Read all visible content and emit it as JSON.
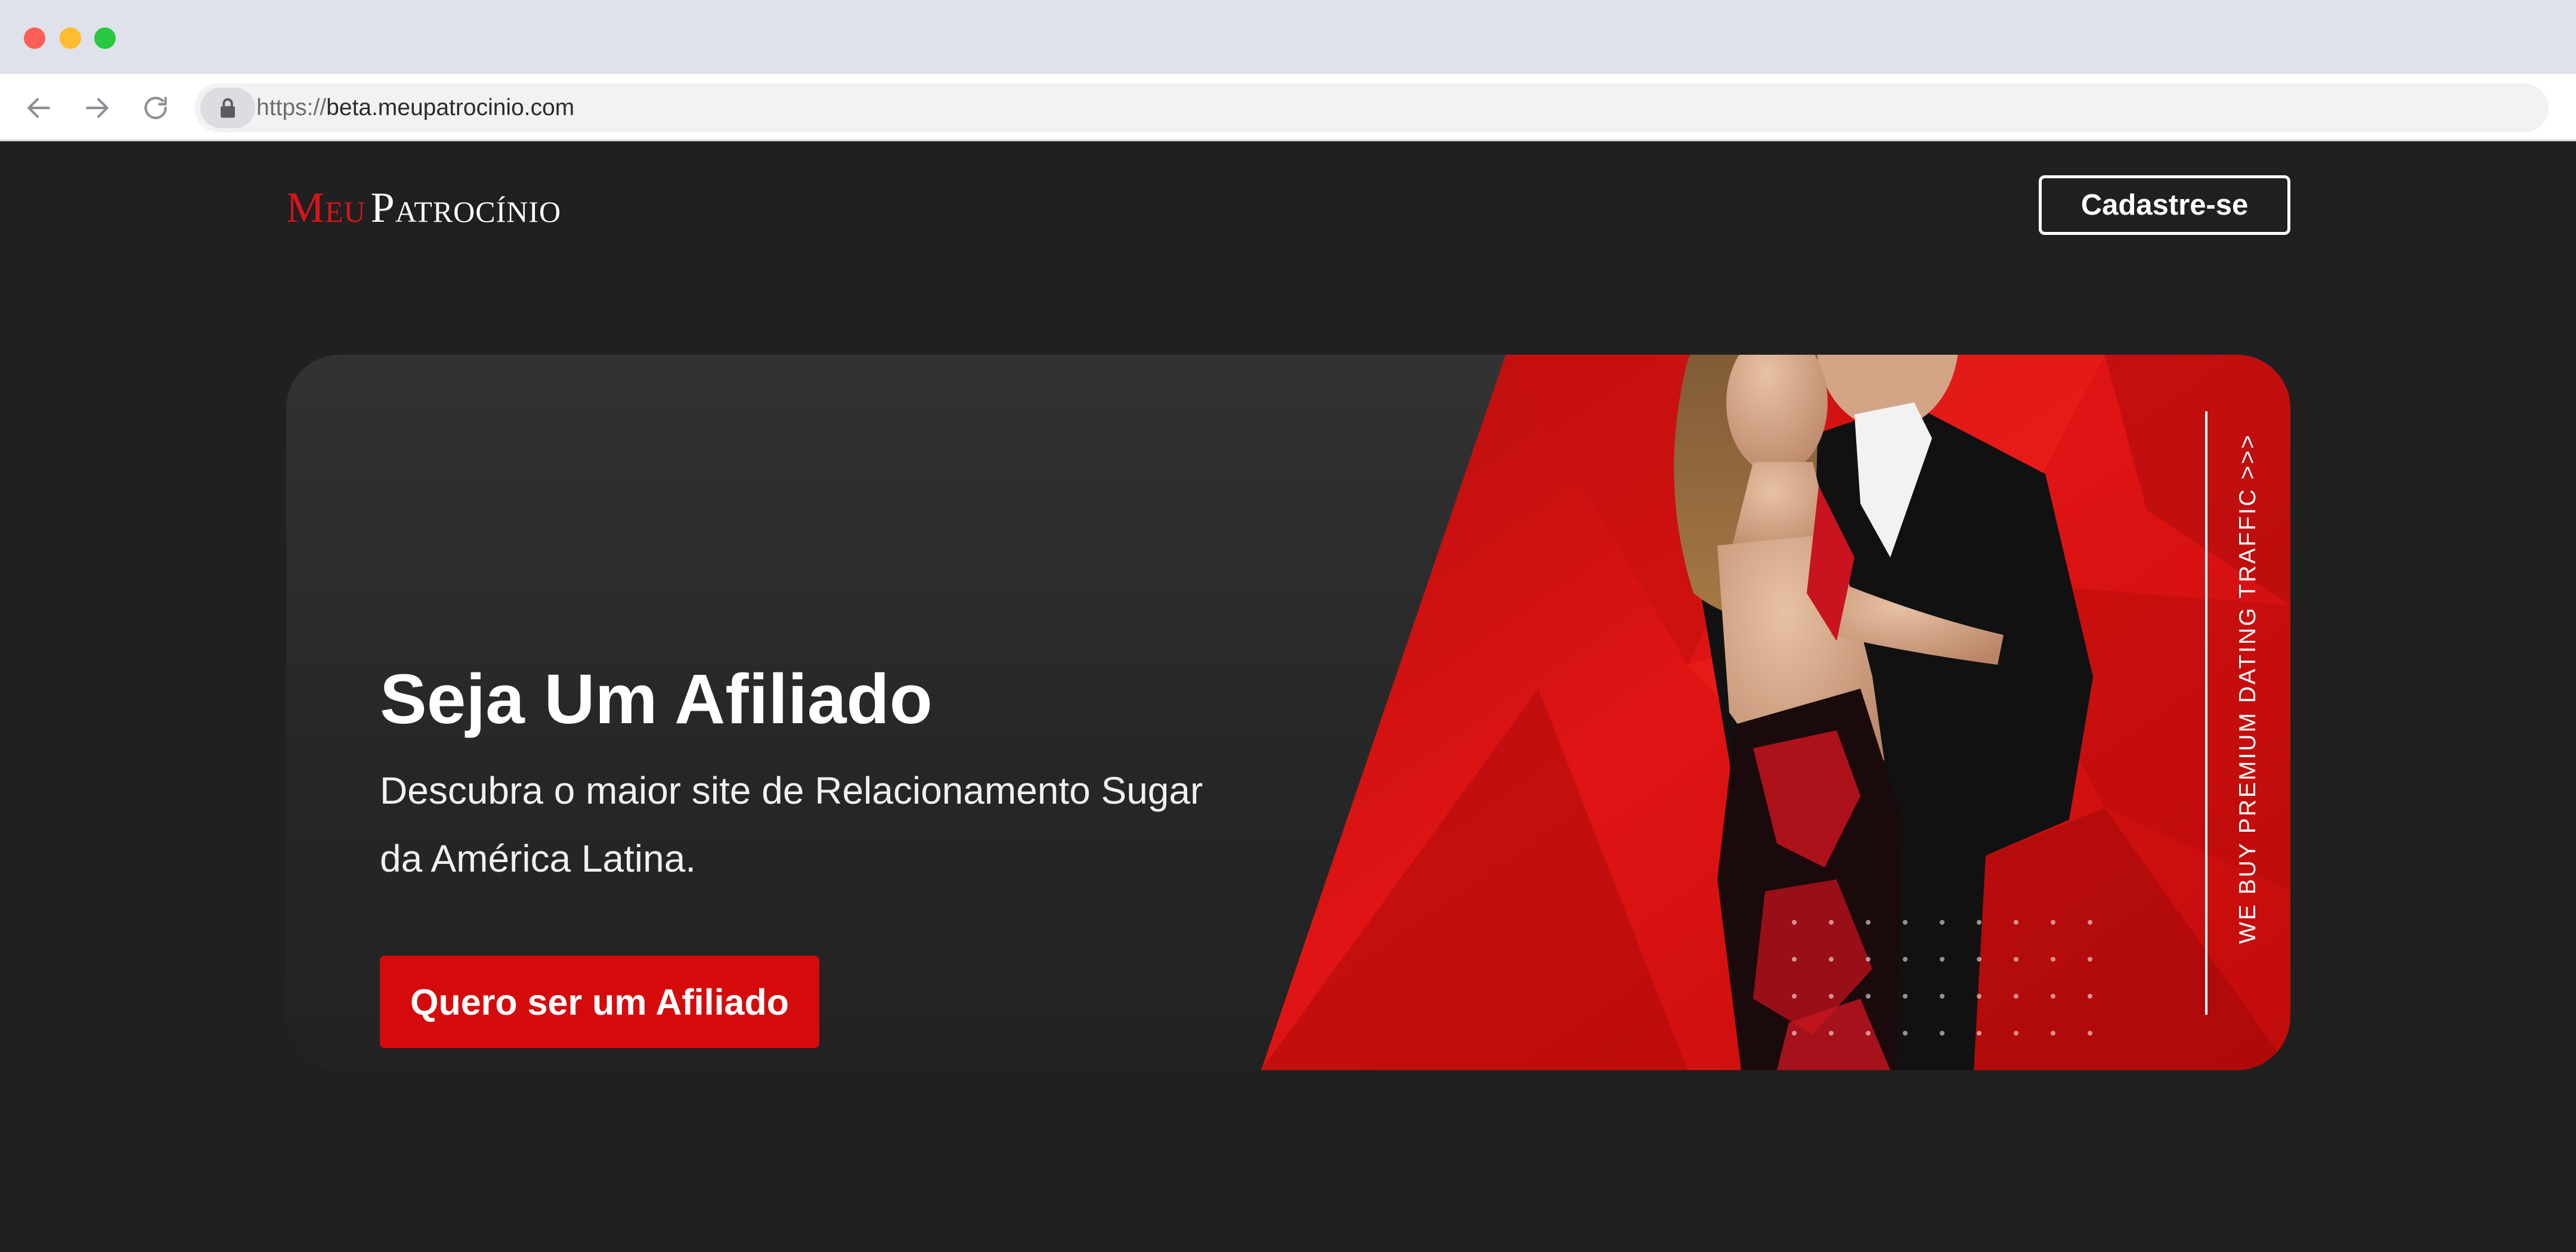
{
  "browser": {
    "url_scheme": "https://",
    "url_host": "beta.meupatrocinio.com",
    "icons": {
      "back": "arrow-left-icon",
      "forward": "arrow-right-icon",
      "reload": "reload-icon",
      "lock": "lock-icon"
    }
  },
  "header": {
    "logo_part1": "Meu",
    "logo_part2": "Patrocínio",
    "signup_label": "Cadastre-se"
  },
  "hero": {
    "title": "Seja Um Afiliado",
    "subtitle": "Descubra o maior site de Relacionamento Sugar da América Latina.",
    "cta_label": "Quero ser um Afiliado",
    "side_text": "WE BUY PREMIUM DATING TRAFFIC >>>"
  },
  "colors": {
    "brand_red": "#d50b0b",
    "page_bg": "#202020"
  }
}
